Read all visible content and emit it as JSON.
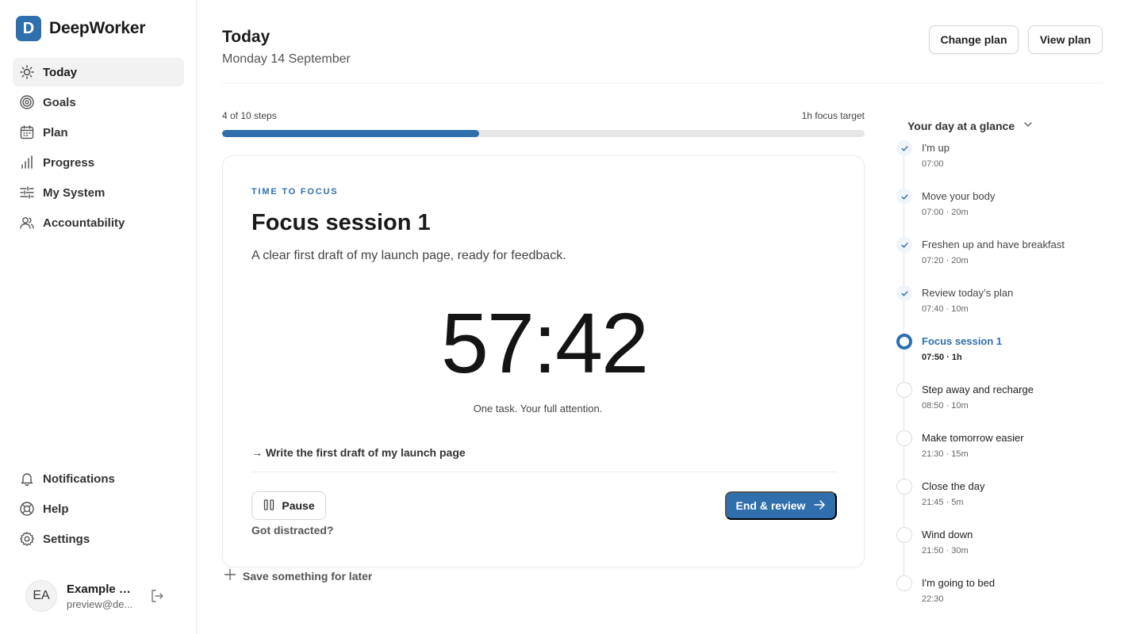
{
  "app": {
    "name": "DeepWorker",
    "logo_letter": "D"
  },
  "sidebar": {
    "items": [
      {
        "label": "Today",
        "icon": "sun-icon",
        "active": true
      },
      {
        "label": "Goals",
        "icon": "target-icon"
      },
      {
        "label": "Plan",
        "icon": "calendar-icon"
      },
      {
        "label": "Progress",
        "icon": "bar-chart-icon"
      },
      {
        "label": "My System",
        "icon": "sliders-icon"
      },
      {
        "label": "Accountability",
        "icon": "users-icon"
      }
    ],
    "bottom_items": [
      {
        "label": "Notifications",
        "icon": "bell-icon"
      },
      {
        "label": "Help",
        "icon": "lifebuoy-icon"
      },
      {
        "label": "Settings",
        "icon": "gear-icon"
      }
    ],
    "user": {
      "initials": "EA",
      "name": "Example a...",
      "email": "preview@de..."
    }
  },
  "header": {
    "title": "Today",
    "date": "Monday 14 September",
    "change_plan_label": "Change plan",
    "view_plan_label": "View plan"
  },
  "progress": {
    "steps_label": "4 of 10 steps",
    "target_label": "1h focus target",
    "fraction": 0.4
  },
  "focus": {
    "eyebrow": "TIME TO FOCUS",
    "title": "Focus session 1",
    "goal": "A clear first draft of my launch page, ready for feedback.",
    "timer": "57:42",
    "caption": "One task. Your full attention.",
    "task": "→ Write the first draft of my launch page",
    "pause_label": "Pause",
    "distracted_label": "Got distracted?",
    "end_label": "End & review"
  },
  "save_later_label": "Save something for later",
  "glance": {
    "title": "Your day at a glance",
    "items": [
      {
        "title": "I'm up",
        "meta": "07:00",
        "status": "done"
      },
      {
        "title": "Move your body",
        "meta": "07:00 · 20m",
        "status": "done"
      },
      {
        "title": "Freshen up and have breakfast",
        "meta": "07:20 · 20m",
        "status": "done"
      },
      {
        "title": "Review today’s plan",
        "meta": "07:40 · 10m",
        "status": "done"
      },
      {
        "title": "Focus session 1",
        "meta": "07:50 · 1h",
        "status": "current"
      },
      {
        "title": "Step away and recharge",
        "meta": "08:50 · 10m",
        "status": "upcoming"
      },
      {
        "title": "Make tomorrow easier",
        "meta": "21:30 · 15m",
        "status": "upcoming"
      },
      {
        "title": "Close the day",
        "meta": "21:45 · 5m",
        "status": "upcoming"
      },
      {
        "title": "Wind down",
        "meta": "21:50 · 30m",
        "status": "upcoming"
      },
      {
        "title": "I'm going to bed",
        "meta": "22:30",
        "status": "upcoming"
      }
    ]
  },
  "colors": {
    "accent": "#2f6fae",
    "track": "#e6e6e6"
  }
}
